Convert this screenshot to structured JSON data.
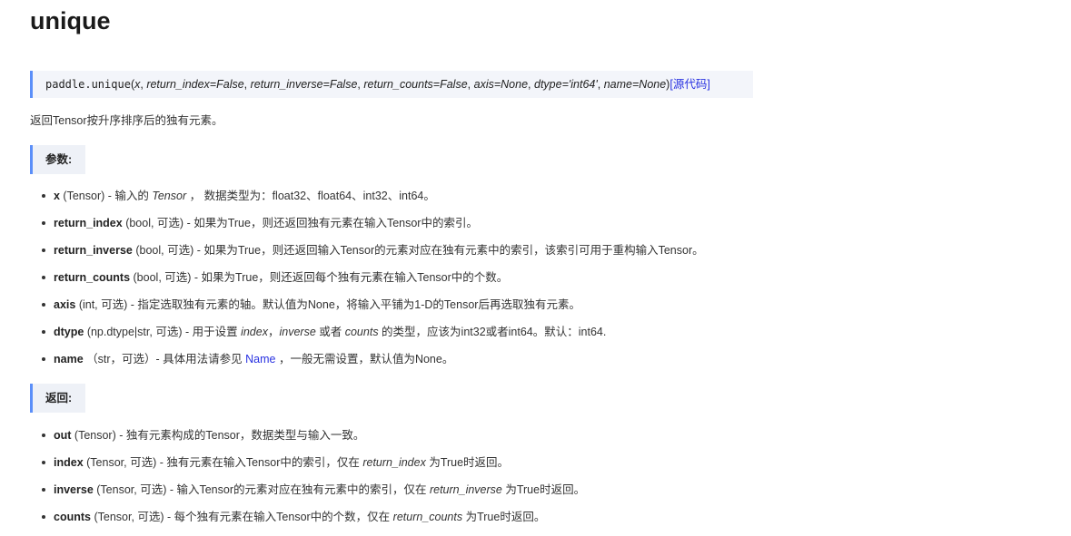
{
  "title": "unique",
  "signature": {
    "prefix": "paddle.",
    "func": "unique",
    "open": "(",
    "args": [
      "x",
      "return_index=False",
      "return_inverse=False",
      "return_counts=False",
      "axis=None",
      "dtype='int64'",
      "name=None"
    ],
    "sep": ", ",
    "close": ")",
    "source_link": "[源代码]"
  },
  "description": "返回Tensor按升序排序后的独有元素。",
  "params_heading": "参数:",
  "params": [
    {
      "name": "x",
      "segments": [
        " (Tensor) - 输入的 ",
        {
          "i": "Tensor"
        },
        " ， 数据类型为：float32、float64、int32、int64。"
      ]
    },
    {
      "name": "return_index",
      "segments": [
        " (bool, 可选) - 如果为True，则还返回独有元素在输入Tensor中的索引。"
      ]
    },
    {
      "name": "return_inverse",
      "segments": [
        " (bool, 可选) - 如果为True，则还返回输入Tensor的元素对应在独有元素中的索引，该索引可用于重构输入Tensor。"
      ]
    },
    {
      "name": "return_counts",
      "segments": [
        " (bool, 可选) - 如果为True，则还返回每个独有元素在输入Tensor中的个数。"
      ]
    },
    {
      "name": "axis",
      "segments": [
        " (int, 可选) - 指定选取独有元素的轴。默认值为None，将输入平铺为1-D的Tensor后再选取独有元素。"
      ]
    },
    {
      "name": "dtype",
      "segments": [
        " (np.dtype|str, 可选) - 用于设置 ",
        {
          "i": "index"
        },
        "，",
        {
          "i": "inverse"
        },
        " 或者 ",
        {
          "i": "counts"
        },
        " 的类型，应该为int32或者int64。默认：int64."
      ]
    },
    {
      "name": "name",
      "segments": [
        " （str，可选）- 具体用法请参见 ",
        {
          "link": "Name"
        },
        " ，一般无需设置，默认值为None。"
      ]
    }
  ],
  "returns_heading": "返回:",
  "returns": [
    {
      "name": "out",
      "segments": [
        " (Tensor) - 独有元素构成的Tensor，数据类型与输入一致。"
      ]
    },
    {
      "name": "index",
      "segments": [
        " (Tensor, 可选) - 独有元素在输入Tensor中的索引，仅在 ",
        {
          "i": "return_index"
        },
        " 为True时返回。"
      ]
    },
    {
      "name": "inverse",
      "segments": [
        " (Tensor, 可选) - 输入Tensor的元素对应在独有元素中的索引，仅在 ",
        {
          "i": "return_inverse"
        },
        " 为True时返回。"
      ]
    },
    {
      "name": "counts",
      "segments": [
        " (Tensor, 可选) - 每个独有元素在输入Tensor中的个数，仅在 ",
        {
          "i": "return_counts"
        },
        " 为True时返回。"
      ]
    }
  ]
}
